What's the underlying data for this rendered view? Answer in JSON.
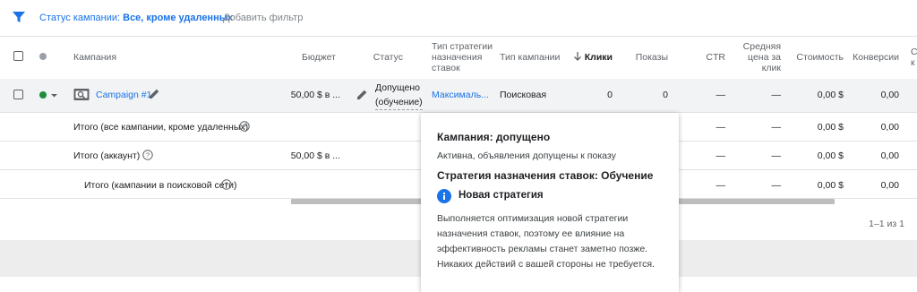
{
  "filter_bar": {
    "status_label": "Статус кампании:",
    "status_value": "Все, кроме удаленных",
    "add_filter_label": "Добавить фильтр"
  },
  "table": {
    "headers": {
      "campaign": "Кампания",
      "budget": "Бюджет",
      "status": "Статус",
      "bid_strategy_type": [
        "Тип стратегии",
        "назначения",
        "ставок"
      ],
      "campaign_type": "Тип кампании",
      "clicks": "Клики",
      "impressions": "Показы",
      "ctr": "CTR",
      "avg_cpc": [
        "Средняя",
        "цена за",
        "клик"
      ],
      "cost": "Стоимость",
      "conversions": "Конверсии",
      "cut": [
        "С",
        "к"
      ]
    },
    "campaign_row": {
      "name": "Campaign #1",
      "budget": "50,00 $ в ...",
      "status_line1": "Допущено",
      "status_line2": "(обучение)",
      "bid_strategy": "Максималь...",
      "campaign_type": "Поисковая",
      "clicks": "0",
      "impressions": "0",
      "ctr": "—",
      "avg_cpc": "—",
      "cost": "0,00 $",
      "conversions": "0,00"
    },
    "totals": [
      {
        "label": "Итого (все кампании, кроме удаленных)",
        "budget": "",
        "ctr": "—",
        "avg_cpc": "—",
        "cost": "0,00 $",
        "conversions": "0,00"
      },
      {
        "label": "Итого (аккаунт)",
        "budget": "50,00 $ в ...",
        "ctr": "—",
        "avg_cpc": "—",
        "cost": "0,00 $",
        "conversions": "0,00"
      },
      {
        "label": "Итого (кампании в поисковой сети)",
        "budget": "",
        "ctr": "—",
        "avg_cpc": "—",
        "cost": "0,00 $",
        "conversions": "0,00"
      }
    ],
    "pagination": "1–1 из 1"
  },
  "tooltip": {
    "title": "Кампания: допущено",
    "subtitle": "Активна, объявления допущены к показу",
    "strategy_title": "Стратегия назначения ставок: Обучение",
    "info_title": "Новая стратегия",
    "body": "Выполняется оптимизация новой стратегии назначения ставок, поэтому ее влияние на эффективность рекламы станет заметно позже. Никаких действий с вашей стороны не требуется."
  },
  "colors": {
    "accent": "#1a73e8",
    "status_green": "#1e8e3e",
    "row_highlight": "#f1f3f4"
  }
}
